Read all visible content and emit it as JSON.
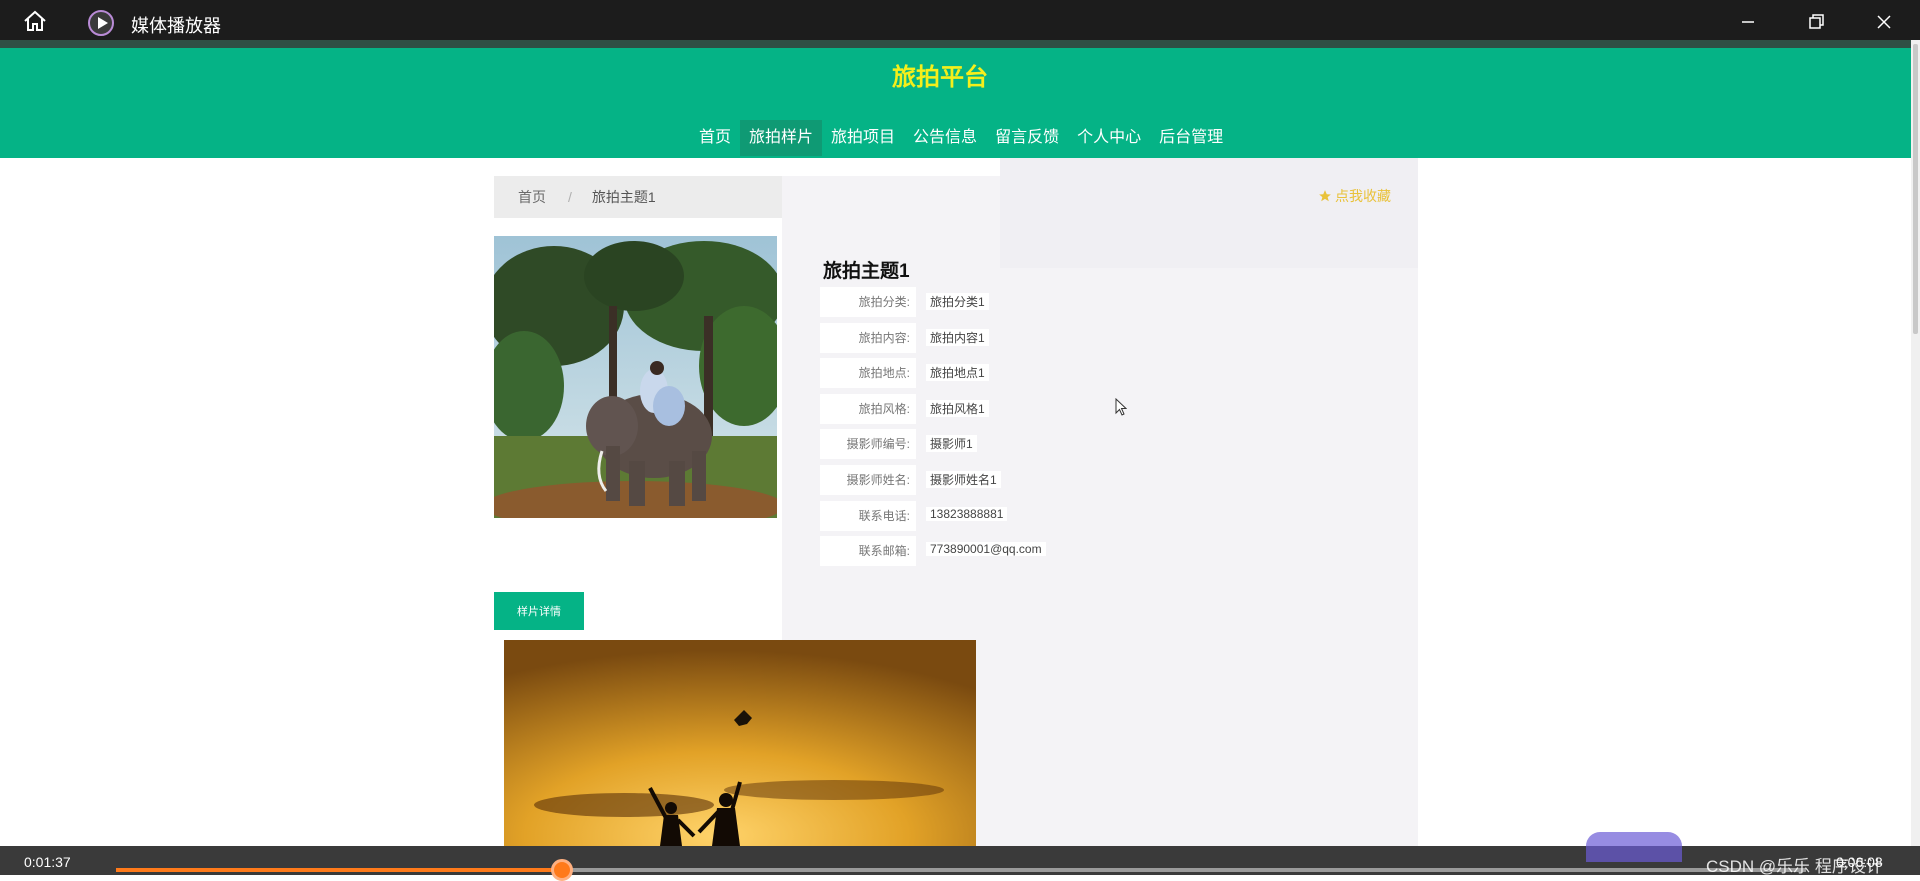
{
  "window": {
    "title": "媒体播放器",
    "icons": [
      "home-icon",
      "media-player-icon",
      "minimize-icon",
      "restore-icon",
      "close-icon"
    ]
  },
  "site": {
    "title": "旅拍平台",
    "nav": [
      "首页",
      "旅拍样片",
      "旅拍项目",
      "公告信息",
      "留言反馈",
      "个人中心",
      "后台管理"
    ],
    "active_nav": "旅拍样片"
  },
  "breadcrumb": {
    "home": "首页",
    "separator": "/",
    "current": "旅拍主题1"
  },
  "favorite": {
    "icon": "star-icon",
    "label": "点我收藏"
  },
  "detail": {
    "title": "旅拍主题1",
    "fields": [
      {
        "label": "旅拍分类:",
        "value": "旅拍分类1"
      },
      {
        "label": "旅拍内容:",
        "value": "旅拍内容1"
      },
      {
        "label": "旅拍地点:",
        "value": "旅拍地点1"
      },
      {
        "label": "旅拍风格:",
        "value": "旅拍风格1"
      },
      {
        "label": "摄影师编号:",
        "value": "摄影师1"
      },
      {
        "label": "摄影师姓名:",
        "value": "摄影师姓名1"
      },
      {
        "label": "联系电话:",
        "value": "13823888881"
      },
      {
        "label": "联系邮箱:",
        "value": "773890001@qq.com"
      }
    ]
  },
  "tabs": {
    "detail_tab": "样片详情"
  },
  "player": {
    "current_time": "0:01:37",
    "total_time": "0:06:08",
    "progress": 0.264,
    "watermark": "CSDN @乐乐 程序设计"
  },
  "colors": {
    "brand_green": "#05b386",
    "title_yellow": "#f5ef1b",
    "progress_orange": "#ff7a1a"
  }
}
